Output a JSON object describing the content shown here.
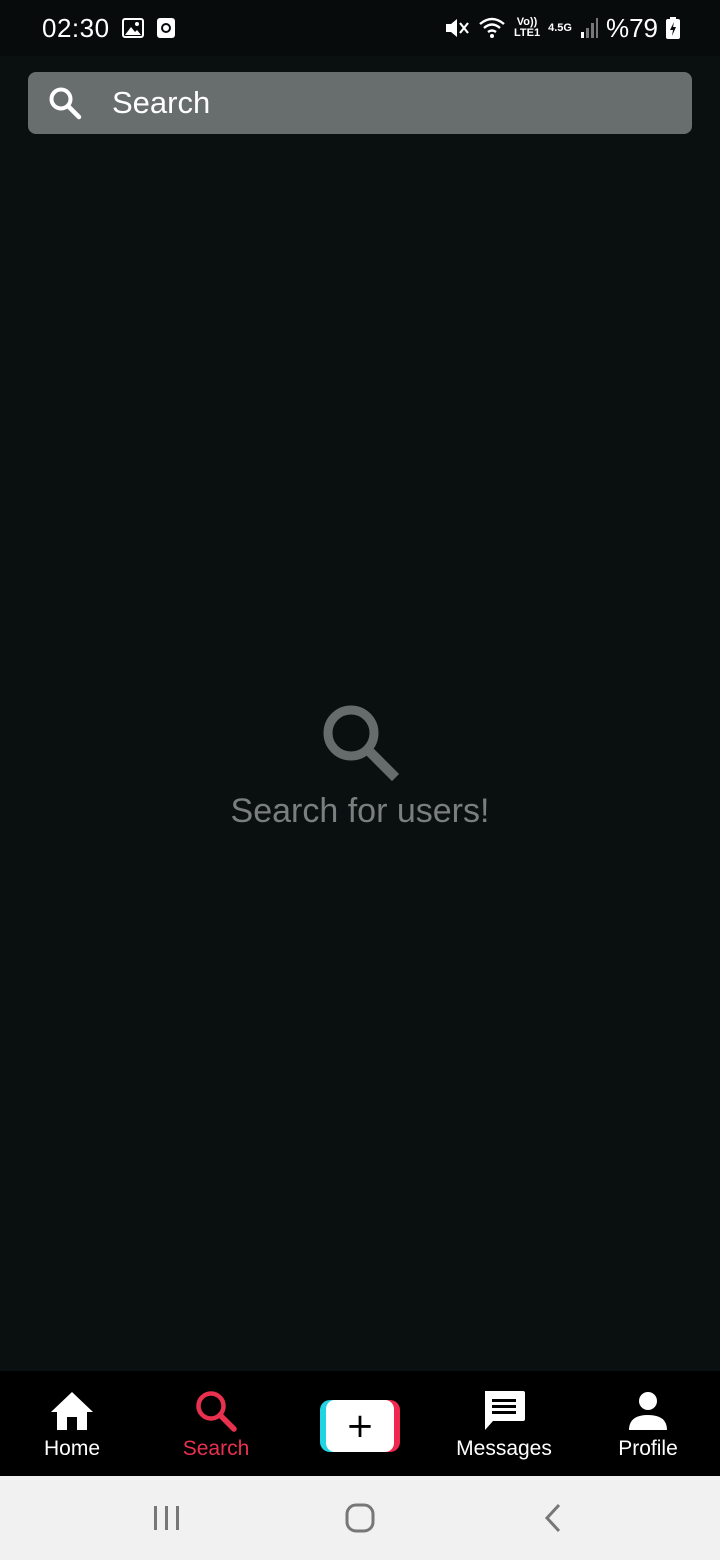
{
  "status_bar": {
    "time": "02:30",
    "network_top": "Vo))",
    "network_bottom": "LTE1",
    "network_gen": "4.5G",
    "battery_percent": "%79",
    "icons": [
      "gallery-icon",
      "screen-record-icon",
      "mute-icon",
      "wifi-icon",
      "volte-icon",
      "signal-icon",
      "battery-icon"
    ]
  },
  "search": {
    "placeholder": "Search",
    "value": ""
  },
  "empty_state": {
    "icon": "search-icon",
    "message": "Search for users!"
  },
  "bottom_nav": {
    "items": [
      {
        "label": "Home",
        "icon": "home-icon",
        "active": false
      },
      {
        "label": "Search",
        "icon": "search-icon",
        "active": true
      },
      {
        "label": "",
        "icon": "plus-icon",
        "active": false
      },
      {
        "label": "Messages",
        "icon": "message-icon",
        "active": false
      },
      {
        "label": "Profile",
        "icon": "person-icon",
        "active": false
      }
    ],
    "active_color": "#e8304f"
  },
  "colors": {
    "background": "#0a0f10",
    "search_bar": "#686d6e",
    "create_cyan": "#22d3e3",
    "create_pink": "#f0284d"
  },
  "system_nav": {
    "buttons": [
      "recents-icon",
      "home-circle-icon",
      "back-icon"
    ]
  }
}
